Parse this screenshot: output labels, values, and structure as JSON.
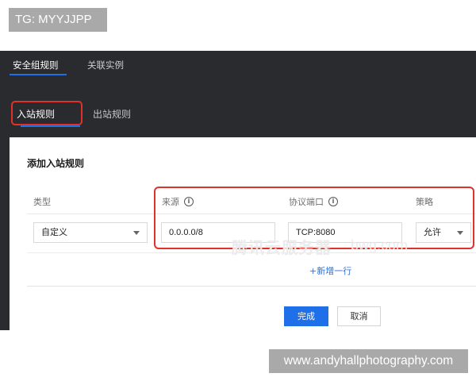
{
  "overlay": {
    "tg_label": "TG: MYYJJPP",
    "site_label": "www.andyhallphotography.com"
  },
  "top_tabs": [
    {
      "label": "安全组规则",
      "active": true
    },
    {
      "label": "关联实例",
      "active": false
    }
  ],
  "sub_tabs": [
    {
      "label": "入站规则",
      "active": true
    },
    {
      "label": "出站规则",
      "active": false
    }
  ],
  "modal": {
    "title": "添加入站规则",
    "columns": {
      "type": "类型",
      "source": "来源",
      "protocol_port": "协议端口",
      "policy": "策略"
    },
    "row": {
      "type_value": "自定义",
      "source_value": "0.0.0.0/8",
      "protocol_port_value": "TCP:8080",
      "policy_value": "允许"
    },
    "add_row_label": "+新增一行",
    "confirm_label": "完成",
    "cancel_label": "取消"
  },
  "watermark": {
    "text": "腾讯云服务器",
    "domain": "bwg.com"
  },
  "colors": {
    "accent": "#1f6fe8",
    "highlight": "#e0322b",
    "dark_bg": "#2a2b2f"
  },
  "icons": {
    "info": "info-icon",
    "dropdown": "chevron-down-icon"
  }
}
